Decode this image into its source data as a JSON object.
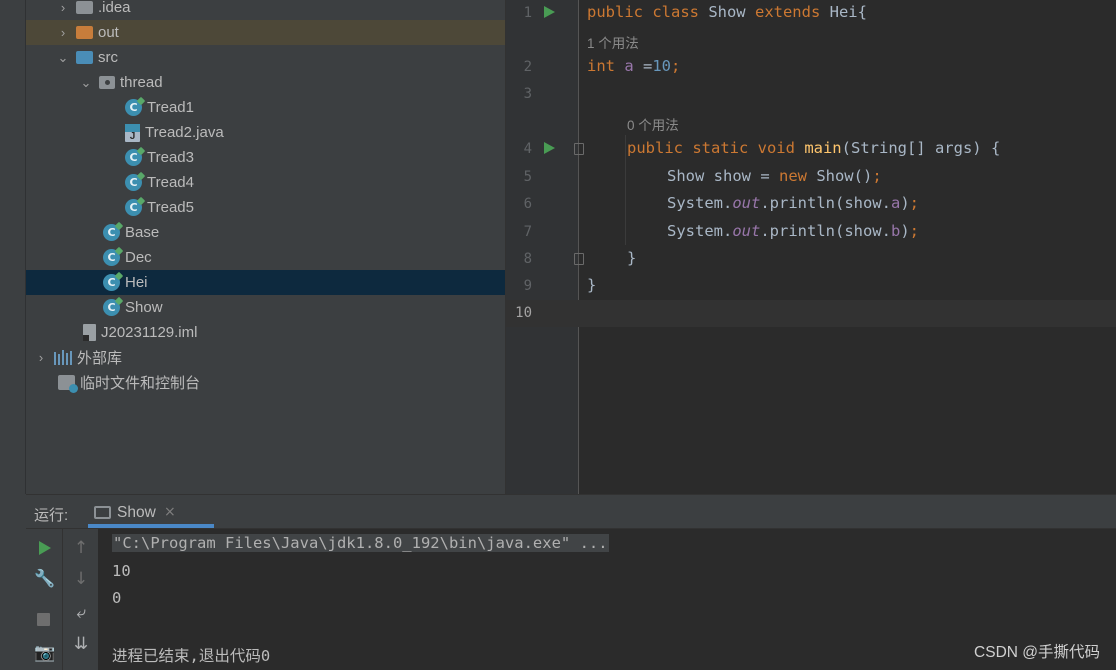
{
  "project_tree": {
    "items": [
      {
        "label": ".idea"
      },
      {
        "label": "out"
      },
      {
        "label": "src"
      },
      {
        "label": "thread"
      },
      {
        "label": "Tread1"
      },
      {
        "label": "Tread2.java",
        "icon_badge": "J"
      },
      {
        "label": "Tread3"
      },
      {
        "label": "Tread4"
      },
      {
        "label": "Tread5"
      },
      {
        "label": "Base"
      },
      {
        "label": "Dec"
      },
      {
        "label": "Hei"
      },
      {
        "label": "Show"
      },
      {
        "label": "J20231129.iml"
      },
      {
        "label": "外部库"
      },
      {
        "label": "临时文件和控制台"
      }
    ],
    "class_badge": "C"
  },
  "editor": {
    "line_numbers": [
      "1",
      "2",
      "3",
      "4",
      "5",
      "6",
      "7",
      "8",
      "9",
      "10"
    ],
    "hints": [
      "1 个用法",
      "0 个用法"
    ],
    "code": {
      "l1_a": "public class",
      "l1_b": " Show ",
      "l1_c": "extends",
      "l1_d": " Hei{",
      "l2_a": "int",
      "l2_b": " a",
      "l2_c": " =",
      "l2_d": "10",
      "l2_e": ";",
      "l4_a": "public static void",
      "l4_b": " main",
      "l4_c": "(String[] args) {",
      "l5_a": "Show show = ",
      "l5_b": "new",
      "l5_c": " Show()",
      "l5_d": ";",
      "l6_a": "System.",
      "l6_b": "out",
      "l6_c": ".println(show.",
      "l6_d": "a",
      "l6_e": ")",
      "l6_f": ";",
      "l7_a": "System.",
      "l7_b": "out",
      "l7_c": ".println(show.",
      "l7_d": "b",
      "l7_e": ")",
      "l7_f": ";",
      "l8": "}",
      "l9": "}"
    }
  },
  "run_panel": {
    "label": "运行:",
    "tab_label": "Show",
    "tab_close": "×",
    "tools": {
      "up": "↑",
      "down": "↓",
      "wrap": "⤶",
      "scroll_end": "⇊",
      "wrench": "🔧",
      "camera": "📷"
    },
    "console": {
      "command": "\"C:\\Program Files\\Java\\jdk1.8.0_192\\bin\\java.exe\" ...",
      "output": [
        "10",
        "0"
      ],
      "exit_message": "进程已结束,退出代码0"
    }
  },
  "watermark": "CSDN @手撕代码",
  "colors": {
    "keyword": "#cc7832",
    "field": "#9876aa",
    "number": "#6897bb",
    "method": "#ffc66d",
    "run_green": "#499c54",
    "selection": "#0d293e"
  }
}
